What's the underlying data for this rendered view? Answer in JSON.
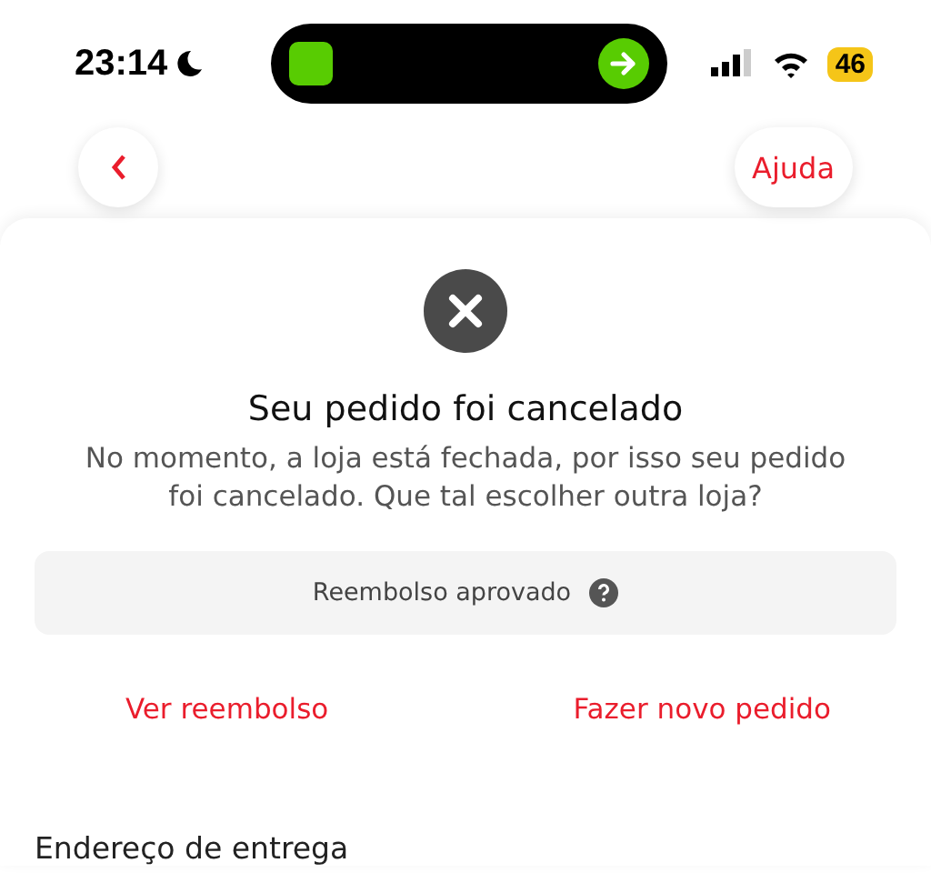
{
  "status_bar": {
    "time": "23:14",
    "battery": "46"
  },
  "nav": {
    "help": "Ajuda"
  },
  "status": {
    "title": "Seu pedido foi cancelado",
    "message": "No momento, a loja está fechada, por isso seu pedido foi cancelado. Que tal escolher outra loja?"
  },
  "refund": {
    "label": "Reembolso aprovado"
  },
  "actions": [
    "Ver reembolso",
    "Fazer novo pedido"
  ],
  "section": {
    "title": "Endereço de entrega"
  }
}
